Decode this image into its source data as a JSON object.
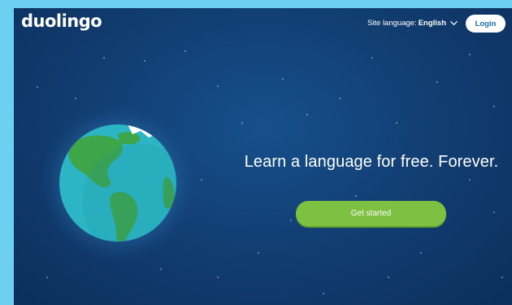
{
  "header": {
    "logo_text": "duolingo",
    "site_language_label": "Site language:",
    "site_language_value": "English",
    "login_label": "Login"
  },
  "hero": {
    "title": "Learn a language for free. Forever.",
    "cta_label": "Get started"
  },
  "colors": {
    "background": "#123f74",
    "accent_green": "#7ec142",
    "globe_ocean": "#2cb5c5",
    "globe_land": "#3ea54a",
    "outer_border": "#6dd0f2"
  },
  "icons": [
    "chevron-down-icon",
    "globe-illustration"
  ]
}
